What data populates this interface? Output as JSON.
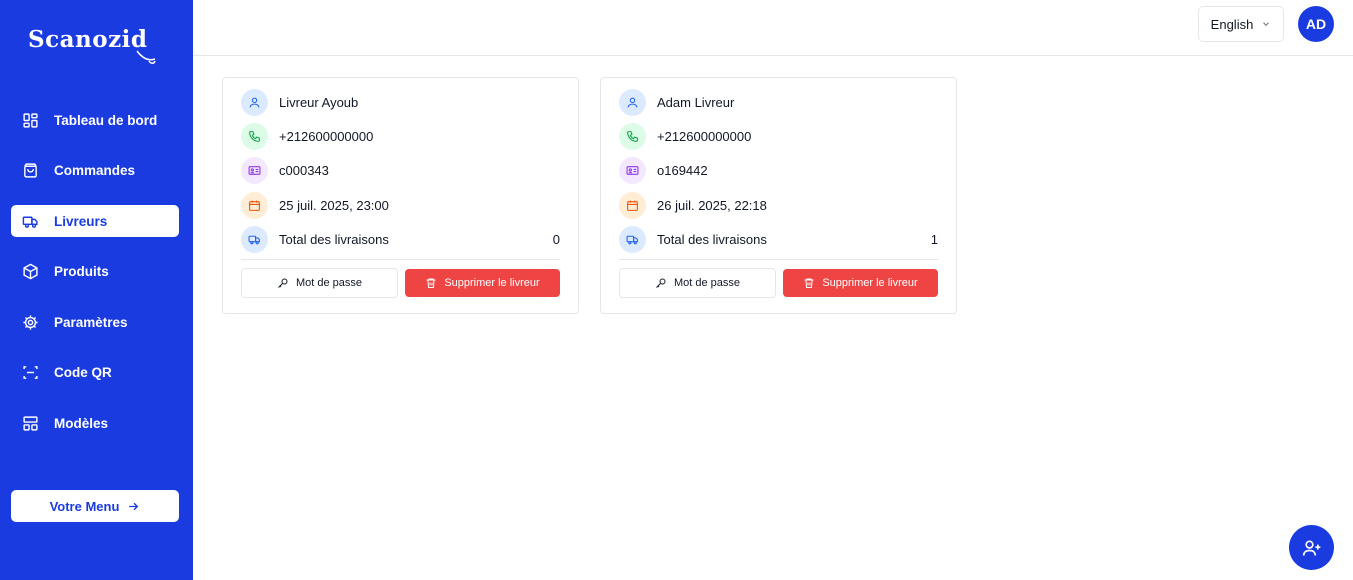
{
  "brand": {
    "name": "Scanozid"
  },
  "sidebar": {
    "items": [
      {
        "label": "Tableau de bord",
        "icon": "grid-icon"
      },
      {
        "label": "Commandes",
        "icon": "bag-icon"
      },
      {
        "label": "Livreurs",
        "icon": "truck-icon",
        "active": true
      },
      {
        "label": "Produits",
        "icon": "box-icon"
      },
      {
        "label": "Paramètres",
        "icon": "gear-icon"
      },
      {
        "label": "Code QR",
        "icon": "scan-icon"
      },
      {
        "label": "Modèles",
        "icon": "layout-icon"
      }
    ],
    "menu_button": "Votre Menu"
  },
  "topbar": {
    "language": "English",
    "avatar": "AD"
  },
  "couriers": [
    {
      "name": "Livreur Ayoub",
      "phone": "+212600000000",
      "id": "c000343",
      "date": "25 juil. 2025, 23:00",
      "total_label": "Total des livraisons",
      "total": "0",
      "password_label": "Mot de passe",
      "delete_label": "Supprimer le livreur"
    },
    {
      "name": "Adam Livreur",
      "phone": "+212600000000",
      "id": "o169442",
      "date": "26 juil. 2025, 22:18",
      "total_label": "Total des livraisons",
      "total": "1",
      "password_label": "Mot de passe",
      "delete_label": "Supprimer le livreur"
    }
  ],
  "colors": {
    "primary": "#1a3be0",
    "danger": "#ef4444"
  }
}
